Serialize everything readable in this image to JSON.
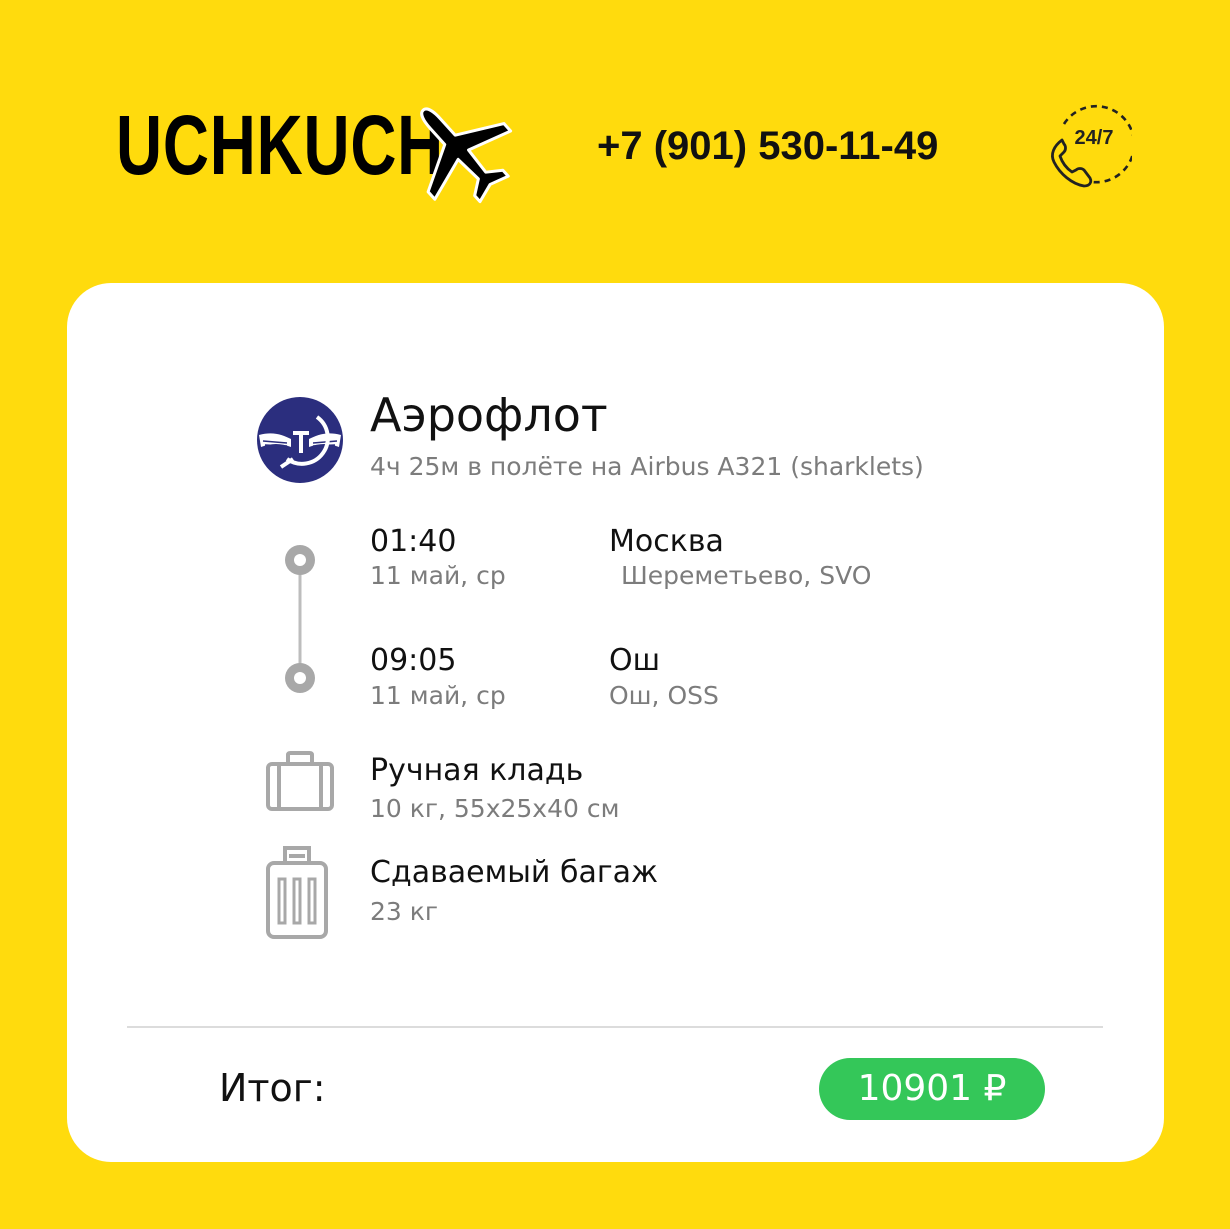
{
  "header": {
    "brand": "UCHKUCH",
    "phone": "+7 (901) 530-11-49",
    "support_label": "24/7",
    "brand_icon": "airplane-icon",
    "support_icon": "phone-24-7-icon"
  },
  "flight": {
    "airline": "Аэрофлот",
    "description": "4ч 25м в полёте на Airbus A321 (sharklets)",
    "airline_logo_icon": "aeroflot-logo",
    "departure": {
      "time": "01:40",
      "date": "11 май, ср",
      "city": "Москва",
      "airport": "Шереметьево, SVO"
    },
    "arrival": {
      "time": "09:05",
      "date": "11 май, ср",
      "city": "Ош",
      "airport": "Ош, OSS"
    }
  },
  "baggage": {
    "hand": {
      "title": "Ручная кладь",
      "details": "10 кг, 55x25x40 см",
      "icon": "briefcase-icon"
    },
    "checked": {
      "title": "Сдаваемый багаж",
      "details": "23 кг",
      "icon": "suitcase-icon"
    }
  },
  "total": {
    "label": "Итог:",
    "price": "10901 ₽"
  },
  "colors": {
    "background": "#FFDB0D",
    "card": "#FFFFFF",
    "price_badge": "#34C759",
    "aeroflot_blue": "#2B2E7E",
    "muted_text": "#7C7C7C",
    "route_line": "#A8A8A8"
  }
}
